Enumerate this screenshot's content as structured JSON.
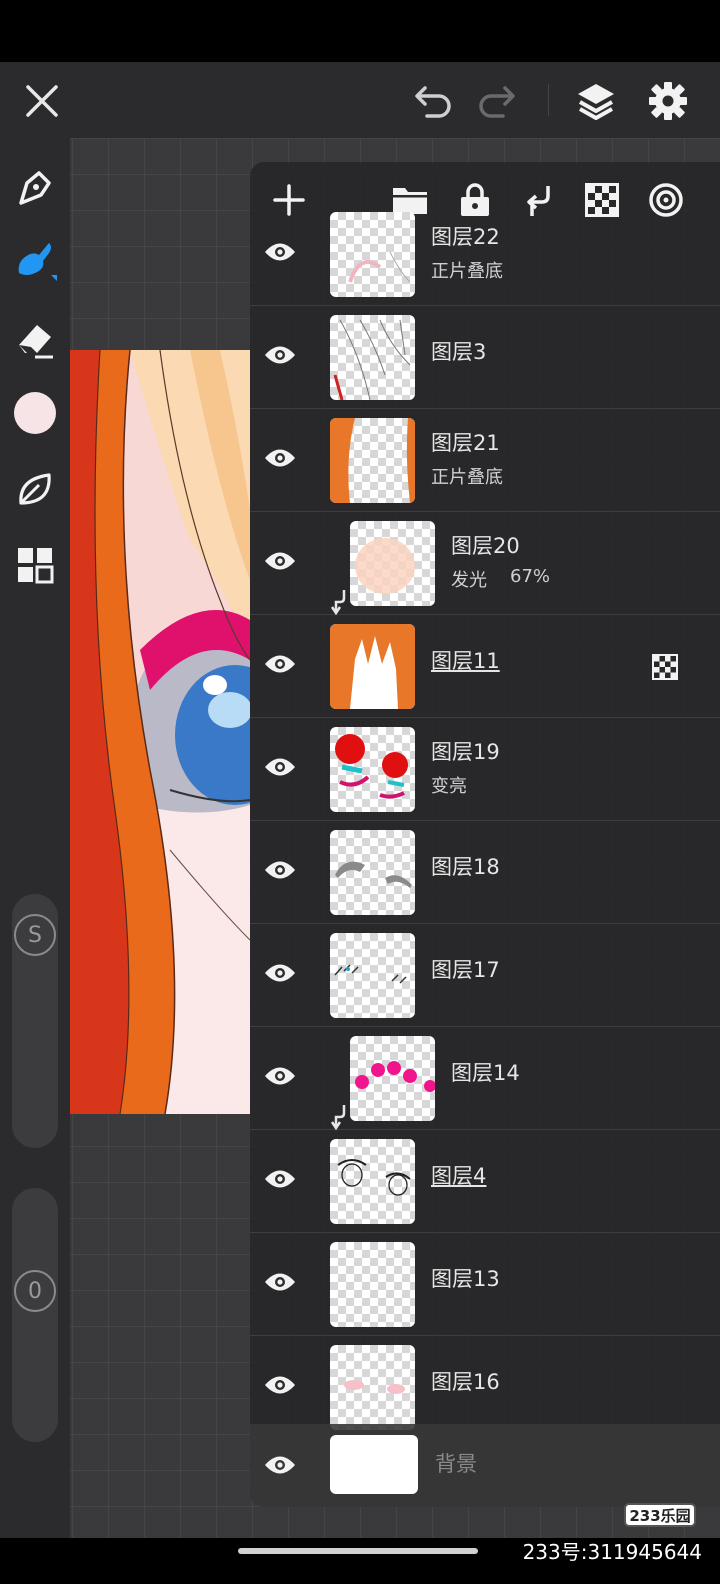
{
  "top_bar": {
    "close_icon": "close-icon",
    "undo_icon": "undo-icon",
    "redo_icon": "redo-icon",
    "layers_icon": "layers-icon",
    "settings_icon": "gear-icon"
  },
  "left_toolbar": {
    "tools": [
      "pen-icon",
      "brush-icon",
      "eraser-icon",
      "color-swatch",
      "leaf-icon",
      "grid-icon"
    ],
    "color": "#f7e4e6",
    "size_slider_label": "S",
    "opacity_slider_label": "0"
  },
  "layers_panel": {
    "toolbar": [
      "add-layer-icon",
      "folder-icon",
      "lock-icon",
      "clip-icon",
      "checker-icon",
      "target-icon"
    ],
    "layers": [
      {
        "name": "图层22",
        "mode": "正片叠底",
        "clipped": false,
        "underlined": false
      },
      {
        "name": "图层3",
        "mode": "",
        "clipped": false,
        "underlined": false
      },
      {
        "name": "图层21",
        "mode": "正片叠底",
        "clipped": false,
        "underlined": false
      },
      {
        "name": "图层20",
        "mode": "发光",
        "opacity": "67%",
        "clipped": true,
        "underlined": false
      },
      {
        "name": "图层11",
        "mode": "",
        "clipped": false,
        "underlined": true,
        "alpha_lock": true
      },
      {
        "name": "图层19",
        "mode": "变亮",
        "clipped": false,
        "underlined": false
      },
      {
        "name": "图层18",
        "mode": "",
        "clipped": false,
        "underlined": false
      },
      {
        "name": "图层17",
        "mode": "",
        "clipped": false,
        "underlined": false
      },
      {
        "name": "图层14",
        "mode": "",
        "clipped": true,
        "underlined": false
      },
      {
        "name": "图层4",
        "mode": "",
        "clipped": false,
        "underlined": true
      },
      {
        "name": "图层13",
        "mode": "",
        "clipped": false,
        "underlined": false
      },
      {
        "name": "图层16",
        "mode": "",
        "clipped": false,
        "underlined": false
      }
    ],
    "background_layer": {
      "name": "背景"
    }
  },
  "watermark": {
    "badge": "233乐园",
    "id_text": "233号:311945644"
  }
}
